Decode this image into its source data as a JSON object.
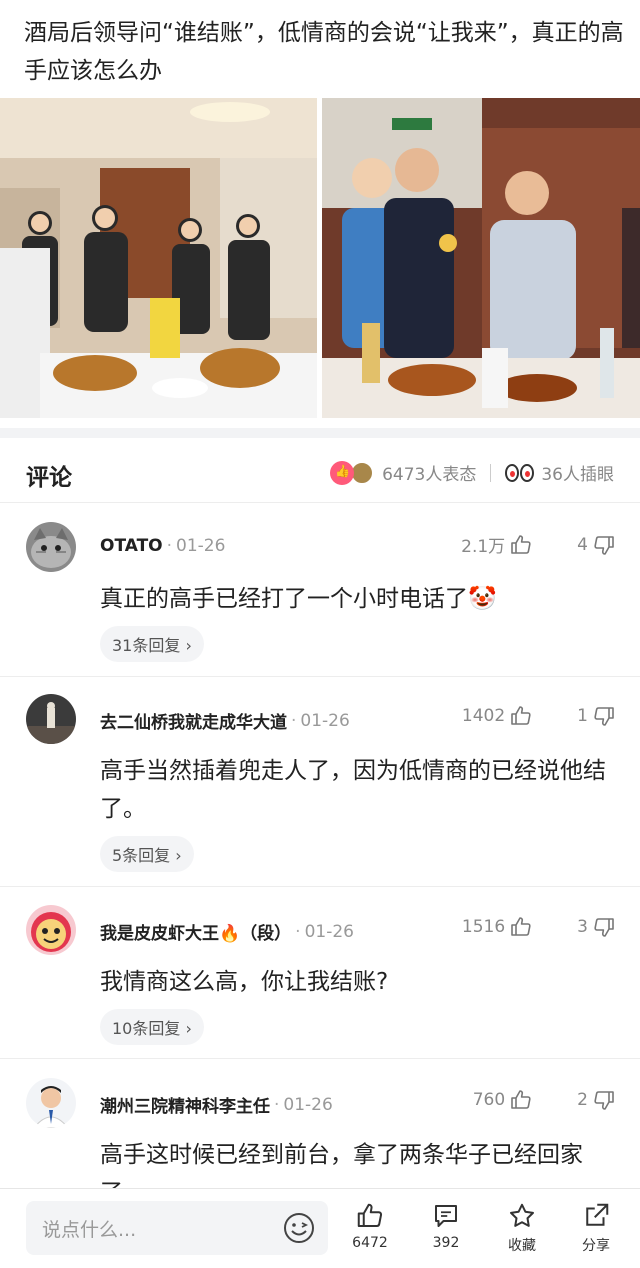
{
  "article": {
    "title": "酒局后领导问“谁结账”，低情商的会说“让我来”，真正的高手应该怎么办"
  },
  "comments_section": {
    "title": "评论",
    "reactions_text": "6473人表态",
    "eyes_text": "36人插眼"
  },
  "comments": [
    {
      "username": "OTATO",
      "date": "01-26",
      "likes": "2.1万",
      "dislikes": "4",
      "text": "真正的高手已经打了一个小时电话了🤡",
      "replies": "31条回复 ›"
    },
    {
      "username": "去二仙桥我就走成华大道",
      "date": "01-26",
      "likes": "1402",
      "dislikes": "1",
      "text": "高手当然插着兜走人了，因为低情商的已经说他结了。",
      "replies": "5条回复 ›"
    },
    {
      "username": "我是皮皮虾大王🔥（段）",
      "date": "01-26",
      "likes": "1516",
      "dislikes": "3",
      "text": "我情商这么高，你让我结账?",
      "replies": "10条回复 ›"
    },
    {
      "username": "潮州三院精神科李主任",
      "date": "01-26",
      "likes": "760",
      "dislikes": "2",
      "text": "高手这时候已经到前台，拿了两条华子已经回家了。",
      "replies": ""
    }
  ],
  "bottom_bar": {
    "input_placeholder": "说点什么...",
    "like_count": "6472",
    "comment_count": "392",
    "favorite_label": "收藏",
    "share_label": "分享"
  },
  "colors": {
    "reaction_pink": "#ff5a7a",
    "text_primary": "#222222",
    "text_secondary": "#999999",
    "pill_bg": "#f3f4f6"
  },
  "icons": [
    "thumb-up-icon",
    "thumb-down-icon",
    "emoji-icon",
    "comment-icon",
    "star-icon",
    "share-icon",
    "chevron-right-icon"
  ]
}
